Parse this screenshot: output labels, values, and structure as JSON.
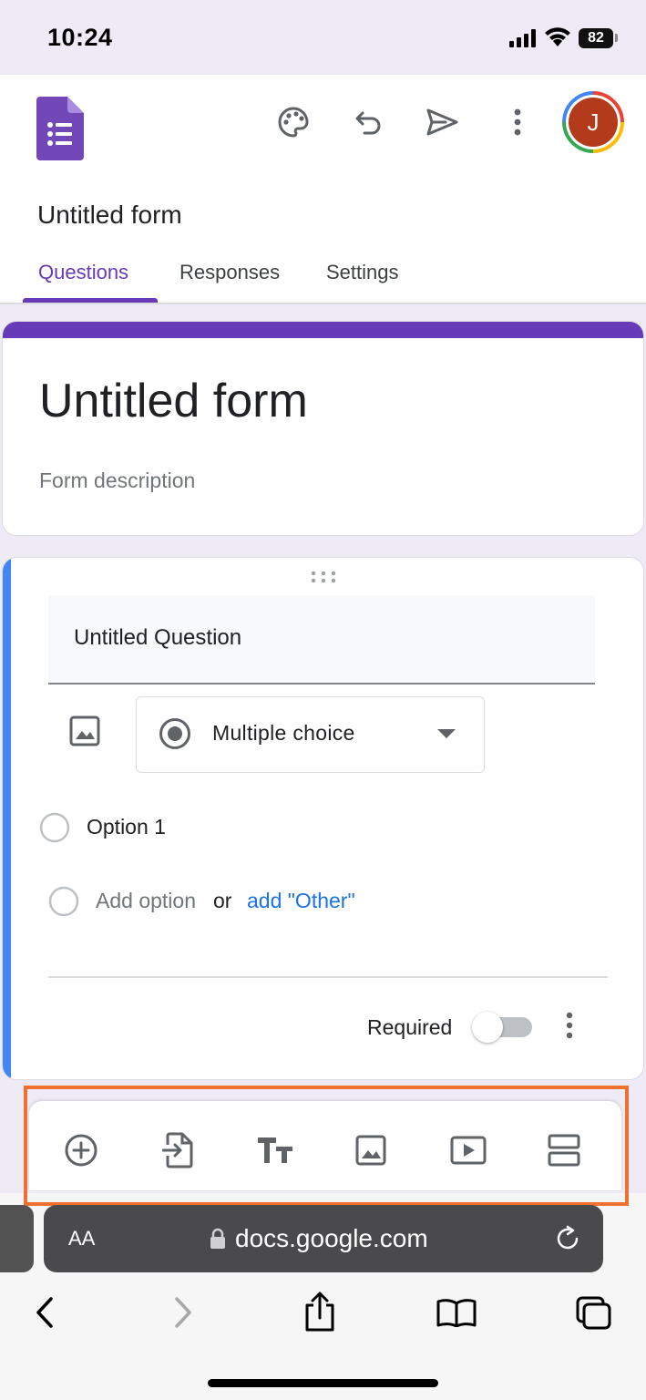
{
  "status_bar": {
    "time": "10:24",
    "battery": "82"
  },
  "header": {
    "app_icon": "google-forms-icon",
    "actions": [
      "palette-icon",
      "undo-icon",
      "send-icon",
      "more-vert-icon"
    ],
    "avatar_initial": "J",
    "form_name": "Untitled form",
    "tabs": [
      {
        "label": "Questions",
        "active": true
      },
      {
        "label": "Responses",
        "active": false
      },
      {
        "label": "Settings",
        "active": false
      }
    ]
  },
  "title_card": {
    "title": "Untitled form",
    "description_placeholder": "Form description"
  },
  "question": {
    "title": "Untitled Question",
    "type": "Multiple choice",
    "options": [
      "Option 1"
    ],
    "add_option": "Add option",
    "or": "or",
    "add_other": "add \"Other\"",
    "required_label": "Required",
    "required": false
  },
  "toolbar": {
    "items": [
      "add-question-icon",
      "import-questions-icon",
      "add-title-icon",
      "add-image-icon",
      "add-video-icon",
      "add-section-icon"
    ]
  },
  "browser": {
    "text_size_label": "AA",
    "url": "docs.google.com"
  },
  "colors": {
    "accent": "#673ab7",
    "question_accent": "#4285f4",
    "link": "#1a73e8",
    "highlight": "#f07030"
  }
}
